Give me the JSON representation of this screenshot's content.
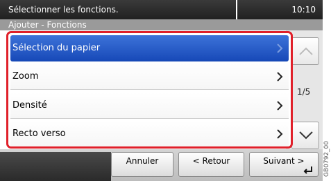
{
  "header": {
    "title": "Sélectionner les fonctions.",
    "time": "10:10"
  },
  "subheader": {
    "title": "Ajouter - Fonctions"
  },
  "list": {
    "items": [
      {
        "label": "Sélection du papier",
        "selected": true
      },
      {
        "label": "Zoom",
        "selected": false
      },
      {
        "label": "Densité",
        "selected": false
      },
      {
        "label": "Recto verso",
        "selected": false
      }
    ]
  },
  "pager": {
    "indicator": "1/5",
    "up_icon": "chevron-up-icon",
    "down_icon": "chevron-down-icon"
  },
  "footer": {
    "cancel_label": "Annuler",
    "back_label": "< Retour",
    "next_label": "Suivant >"
  },
  "side_code": "GB0792_00",
  "colors": {
    "accent": "#e0202a",
    "selected": "#1f55c4",
    "titlebar": "#2a2a2a"
  }
}
